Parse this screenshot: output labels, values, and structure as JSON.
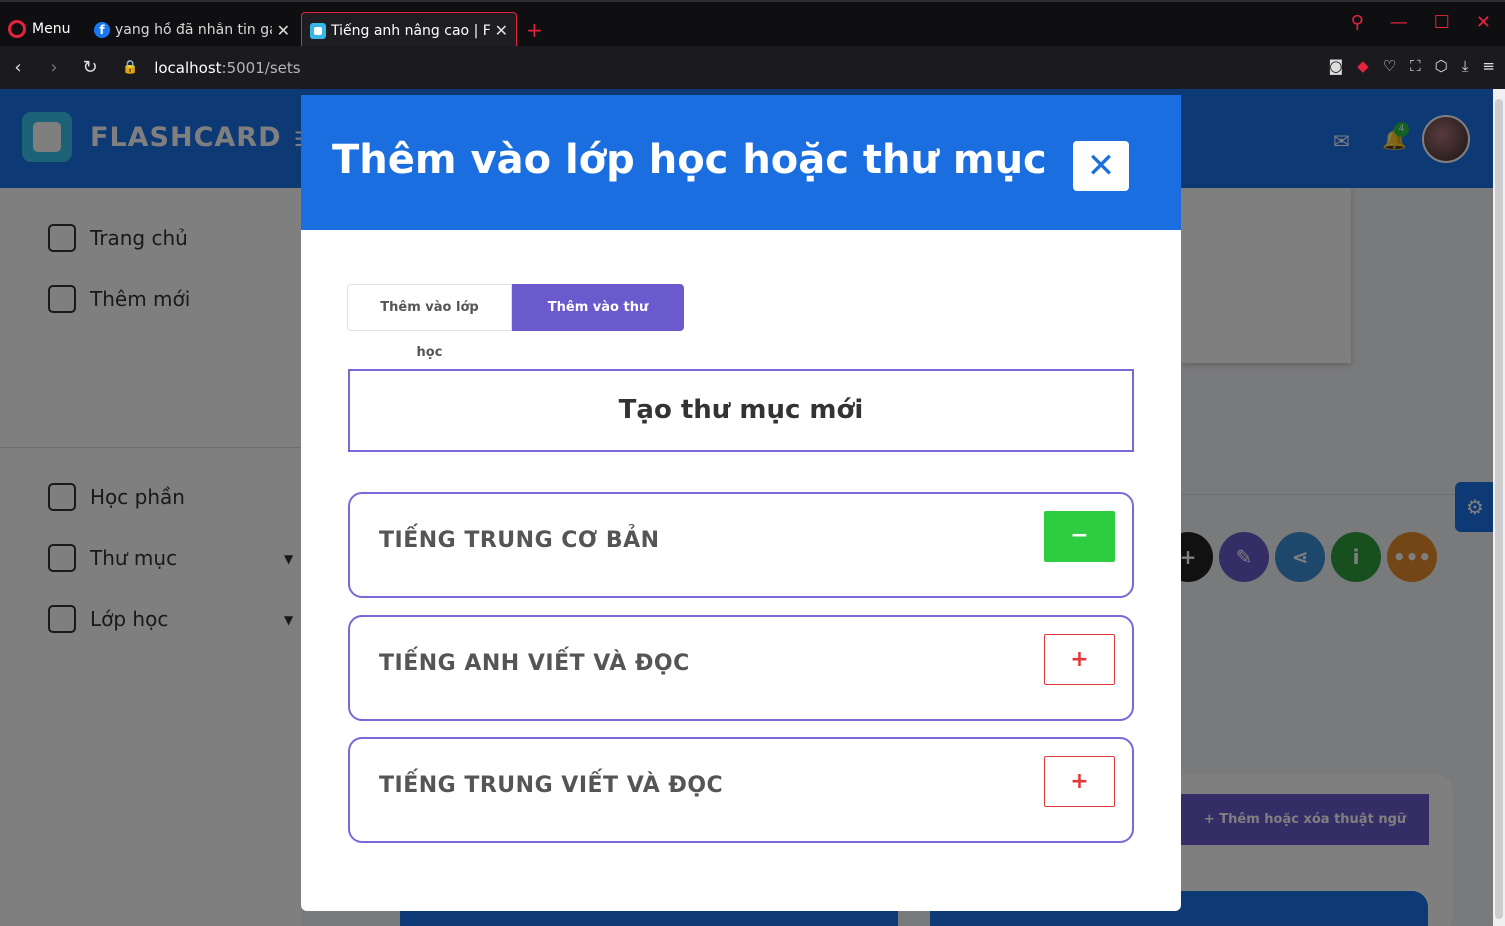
{
  "browser": {
    "menu_label": "Menu",
    "tabs": [
      {
        "title": "yang hồ đã nhắn tin gay",
        "close": "✕"
      },
      {
        "title": "Tiếng anh nâng cao | Flas",
        "close": "✕"
      }
    ],
    "new_tab": "+",
    "url_host": "localhost",
    "url_path": ":5001/sets"
  },
  "app": {
    "brand": "FLASHCARD",
    "notification_count": "4",
    "sidebar": {
      "items": [
        {
          "label": "Trang chủ"
        },
        {
          "label": "Thêm mới"
        },
        {
          "label": "Học phần"
        },
        {
          "label": "Thư mục"
        },
        {
          "label": "Lớp học"
        }
      ]
    },
    "background_button": "Thêm hoặc xóa thuật ngữ"
  },
  "modal": {
    "title": "Thêm vào lớp học hoặc thư mục",
    "close_icon": "✕",
    "tabs": [
      {
        "label": "Thêm vào lớp học",
        "active": false
      },
      {
        "label": "Thêm vào thư mục",
        "active": true
      }
    ],
    "create_folder_label": "Tạo thư mục mới",
    "folders": [
      {
        "name": "TIẾNG TRUNG CƠ BẢN",
        "action": "−",
        "state": "added"
      },
      {
        "name": "TIẾNG ANH VIẾT VÀ ĐỌC",
        "action": "+",
        "state": "not-added"
      },
      {
        "name": "TIẾNG TRUNG VIẾT VÀ ĐỌC",
        "action": "+",
        "state": "not-added"
      }
    ]
  },
  "colors": {
    "primary": "#1a6edf",
    "accent": "#6a5acd",
    "remove": "#2ecc40",
    "add": "#e03a3a"
  }
}
